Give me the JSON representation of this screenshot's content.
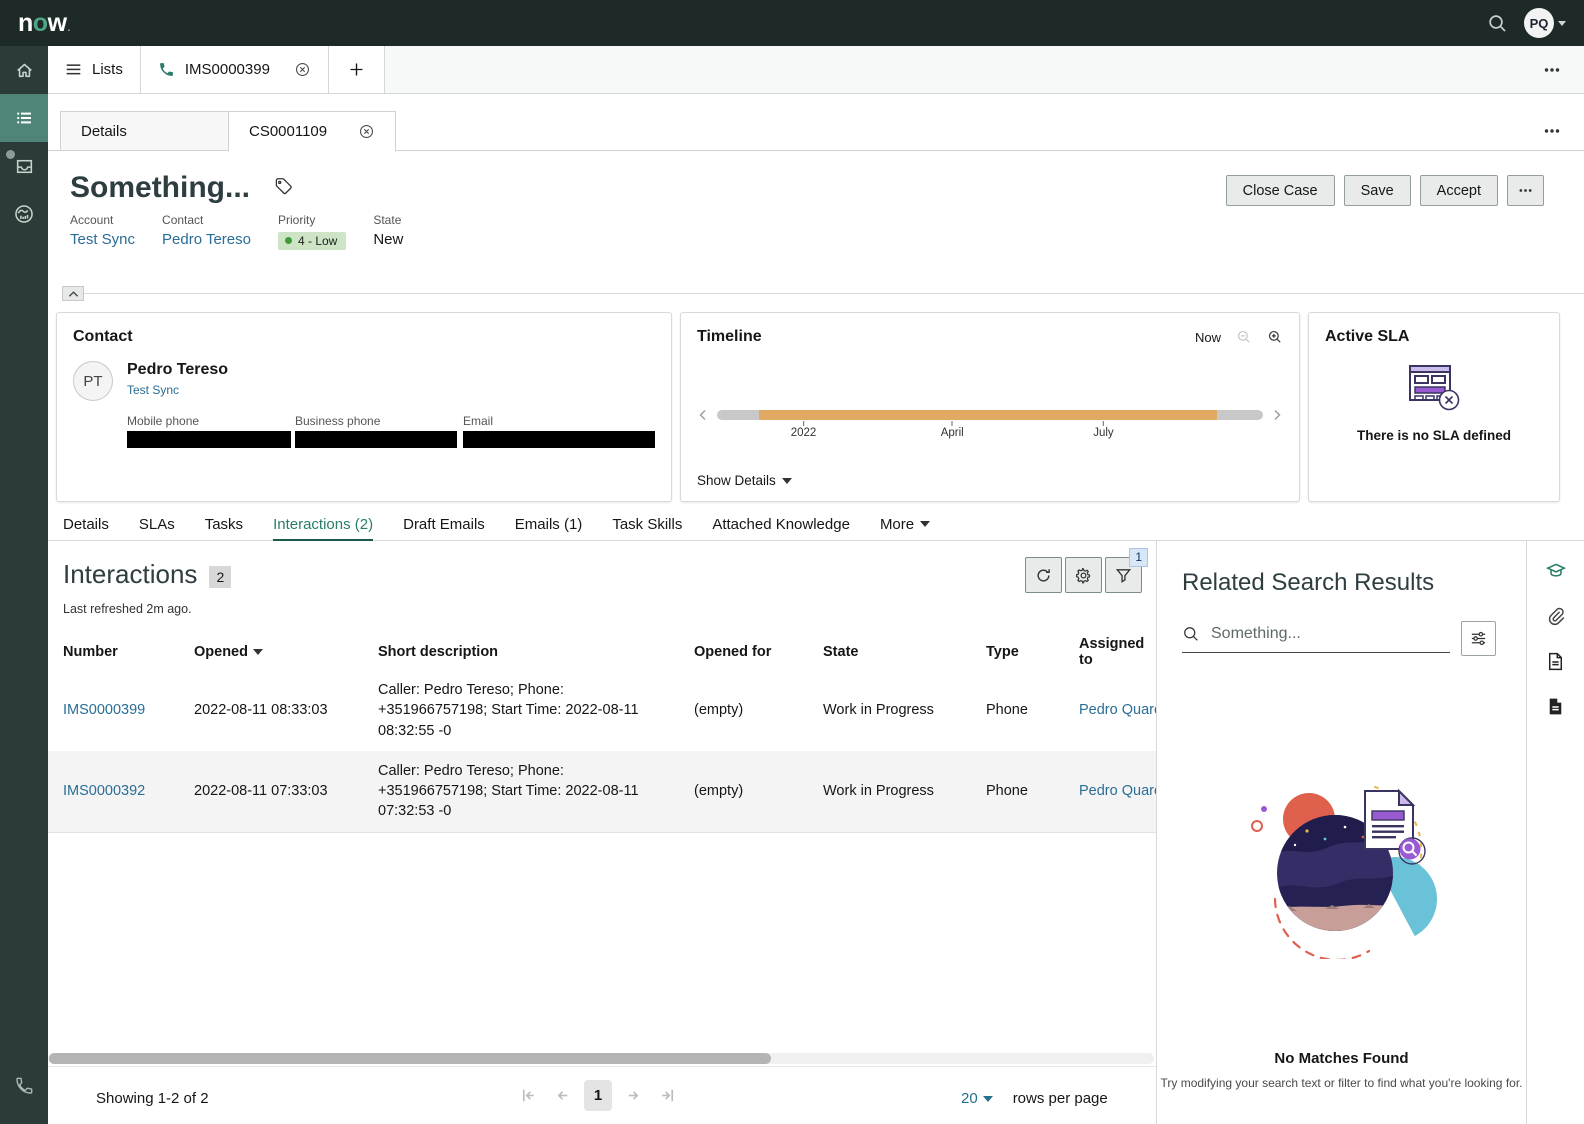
{
  "topbar": {
    "logo_n": "n",
    "logo_o": "o",
    "logo_w": "w",
    "logo_tm": ".",
    "avatar_initials": "PQ"
  },
  "workspace_tabs": {
    "lists": "Lists",
    "record": "IMS0000399"
  },
  "subtabs": {
    "details": "Details",
    "case": "CS0001109"
  },
  "case": {
    "title": "Something...",
    "account_label": "Account",
    "account": "Test Sync",
    "contact_label": "Contact",
    "contact": "Pedro Tereso",
    "priority_label": "Priority",
    "priority": "4 - Low",
    "state_label": "State",
    "state": "New",
    "btn_close_case": "Close Case",
    "btn_save": "Save",
    "btn_accept": "Accept"
  },
  "contact_card": {
    "title": "Contact",
    "initials": "PT",
    "name": "Pedro Tereso",
    "account": "Test Sync",
    "mobile_label": "Mobile phone",
    "business_label": "Business phone",
    "email_label": "Email"
  },
  "timeline_card": {
    "title": "Timeline",
    "now_label": "Now",
    "ticks": [
      "2022",
      "April",
      "July"
    ],
    "show_details": "Show Details"
  },
  "sla_card": {
    "title": "Active SLA",
    "empty_text": "There is no SLA defined"
  },
  "record_tabs": [
    "Details",
    "SLAs",
    "Tasks",
    "Interactions (2)",
    "Draft Emails",
    "Emails (1)",
    "Task Skills",
    "Attached Knowledge",
    "More"
  ],
  "interactions": {
    "title": "Interactions",
    "count": "2",
    "refreshed": "Last refreshed 2m ago.",
    "filter_badge": "1",
    "columns": {
      "number": "Number",
      "opened": "Opened",
      "short_description": "Short description",
      "opened_for": "Opened for",
      "state": "State",
      "type": "Type",
      "assigned_to": "Assigned to"
    },
    "rows": [
      {
        "number": "IMS0000399",
        "opened": "2022-08-11 08:33:03",
        "short_description": "Caller: Pedro Tereso; Phone: +351966757198; Start Time: 2022-08-11 08:32:55 -0",
        "opened_for": "(empty)",
        "state": "Work in Progress",
        "type": "Phone",
        "assigned_to": "Pedro Quare"
      },
      {
        "number": "IMS0000392",
        "opened": "2022-08-11 07:33:03",
        "short_description": "Caller: Pedro Tereso; Phone: +351966757198; Start Time: 2022-08-11 07:32:53 -0",
        "opened_for": "(empty)",
        "state": "Work in Progress",
        "type": "Phone",
        "assigned_to": "Pedro Quare"
      }
    ],
    "footer": {
      "showing": "Showing 1-2 of 2",
      "page": "1",
      "page_size": "20",
      "rows_per_page": "rows per page"
    }
  },
  "related_search": {
    "title": "Related Search Results",
    "query": "Something...",
    "no_matches": "No Matches Found",
    "hint": "Try modifying your search text or filter to find what you're looking for."
  },
  "colors": {
    "sidebar_active": "#4e8578",
    "link": "#2a6d96",
    "tab_active_green": "#2a7d6a",
    "timeline_orange": "#e2a963",
    "priority_badge_bg": "#cde5c4",
    "priority_dot": "#3f9c3b",
    "illustration_purple": "#9a5bd2",
    "topbar_bg": "#1d2a27"
  }
}
